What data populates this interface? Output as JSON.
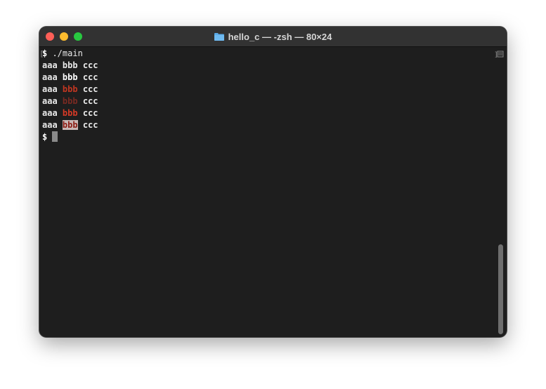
{
  "window": {
    "title": "hello_c — -zsh — 80×24"
  },
  "terminal": {
    "lines": [
      {
        "prompt": "$ ",
        "command": "./main"
      },
      {
        "a": "aaa ",
        "b": "bbb",
        "c": " ccc"
      },
      {
        "a": "aaa ",
        "b": "bbb",
        "c": " ccc"
      },
      {
        "a": "aaa ",
        "b": "bbb",
        "c": " ccc"
      },
      {
        "a": "aaa ",
        "b": "bbb",
        "c": " ccc"
      },
      {
        "a": "aaa ",
        "b": "bbb",
        "c": " ccc"
      },
      {
        "a": "aaa ",
        "b": "bbb",
        "c": " ccc"
      }
    ],
    "final_prompt": "$ "
  },
  "colors": {
    "background": "#1e1e1e",
    "titlebar": "#323232",
    "red": "#c23621"
  }
}
